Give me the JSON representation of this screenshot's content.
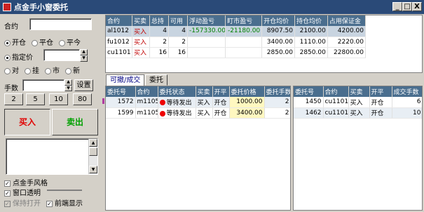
{
  "window": {
    "title": "点金手小窗委托",
    "min": "_",
    "max": "□",
    "close": "X"
  },
  "order": {
    "contract_label": "合约",
    "contract_value": "",
    "open_label": "开仓",
    "close_label": "平仓",
    "closetoday_label": "平今",
    "limit_label": "指定价",
    "price_value": "",
    "opp_label": "对",
    "queue_label": "挂",
    "market_label": "市",
    "new_label": "新",
    "qty_label": "手数",
    "qty_value": "",
    "settings_label": "设置",
    "quick_qty": [
      "2",
      "5",
      "10",
      "80"
    ],
    "buy_label": "买入",
    "sell_label": "卖出"
  },
  "options": {
    "style_label": "点金手风格",
    "transparent_label": "窗口透明",
    "keep_open_label": "保持打开",
    "front_label": "前端显示"
  },
  "positions": {
    "headers": [
      "合约",
      "买卖",
      "总持",
      "可用",
      "浮动盈亏",
      "盯市盈亏",
      "开仓均价",
      "持仓均价",
      "占用保证金"
    ],
    "rows": [
      [
        "al1012",
        "买入",
        "4",
        "4",
        "-157330.00",
        "-21180.00",
        "8907.50",
        "2100.00",
        "4200.00"
      ],
      [
        "fu1012",
        "买入",
        "2",
        "2",
        "",
        "",
        "3400.00",
        "1110.00",
        "2220.00"
      ],
      [
        "cu1101",
        "买入",
        "16",
        "16",
        "",
        "",
        "2850.00",
        "2850.00",
        "22800.00"
      ]
    ]
  },
  "tabs": {
    "active": "可撤/成交",
    "other": "委托"
  },
  "orders": {
    "headers": [
      "委托号",
      "合约",
      "委托状态",
      "买卖",
      "开平",
      "委托价格",
      "委托手数"
    ],
    "rows": [
      [
        "1572",
        "m1105",
        "等待发出",
        "买入",
        "开仓",
        "1000.00",
        "2"
      ],
      [
        "1599",
        "m1105",
        "等待发出",
        "买入",
        "开仓",
        "3400.00",
        "2"
      ]
    ]
  },
  "trades": {
    "headers": [
      "委托号",
      "合约",
      "买卖",
      "开平",
      "成交手数"
    ],
    "rows": [
      [
        "1450",
        "cu1101",
        "买入",
        "开仓",
        "6"
      ],
      [
        "1462",
        "cu1101",
        "买入",
        "开仓",
        "10"
      ]
    ]
  },
  "colors": {
    "titlebar": "#2a4a78",
    "header": "#4a6e8e",
    "buy": "#e00000",
    "sell": "#00a000",
    "negative": "#008000",
    "loss": "#c00000",
    "highlight": "#fff8c0"
  }
}
